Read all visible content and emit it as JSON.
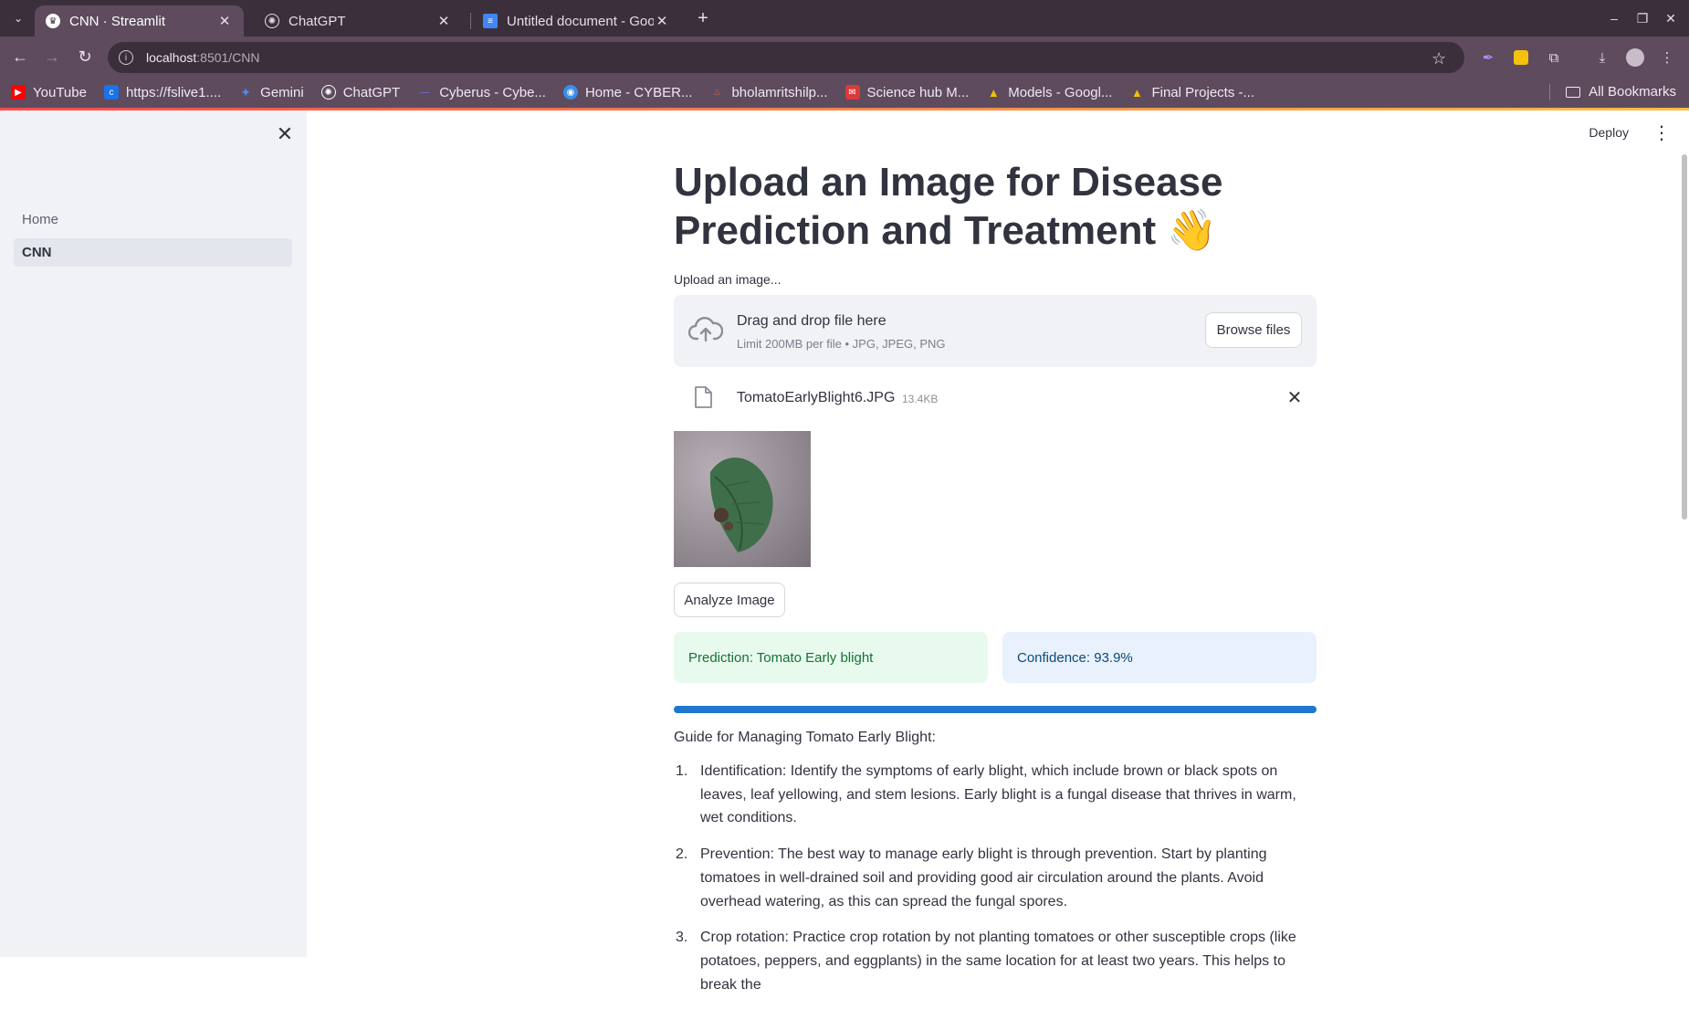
{
  "browser": {
    "tabs": [
      {
        "title": "CNN · Streamlit",
        "active": true
      },
      {
        "title": "ChatGPT",
        "active": false
      },
      {
        "title": "Untitled document - Goo",
        "active": false
      }
    ],
    "url": {
      "host": "localhost",
      "rest": ":8501/CNN"
    },
    "bookmarks": [
      {
        "label": "YouTube",
        "icon": "youtube-icon",
        "color": "#ff0000"
      },
      {
        "label": "https://fslive1....",
        "icon": "site-icon",
        "color": "#1a73e8"
      },
      {
        "label": "Gemini",
        "icon": "gemini-icon",
        "color": "#4a8af4"
      },
      {
        "label": "ChatGPT",
        "icon": "chatgpt-icon",
        "color": "#ffffff"
      },
      {
        "label": "Cyberus - Cybe...",
        "icon": "cyberus-icon",
        "color": "#6f7cff"
      },
      {
        "label": "Home - CYBER...",
        "icon": "cyber-icon",
        "color": "#3a8ee6"
      },
      {
        "label": "bholamritshilp...",
        "icon": "bholamritshilp-icon",
        "color": "#e8703a"
      },
      {
        "label": "Science hub M...",
        "icon": "sciencehub-icon",
        "color": "#d93b3b"
      },
      {
        "label": "Models - Googl...",
        "icon": "drive-icon",
        "color": "#fbbc04"
      },
      {
        "label": "Final Projects -...",
        "icon": "drive-icon",
        "color": "#fbbc04"
      }
    ],
    "all_bookmarks": "All Bookmarks"
  },
  "sidebar": {
    "items": [
      {
        "label": "Home",
        "active": false
      },
      {
        "label": "CNN",
        "active": true
      }
    ]
  },
  "header": {
    "deploy": "Deploy"
  },
  "main": {
    "title": "Upload an Image for Disease Prediction and Treatment 👋",
    "uploader": {
      "label": "Upload an image...",
      "drop_title": "Drag and drop file here",
      "drop_sub": "Limit 200MB per file • JPG, JPEG, PNG",
      "browse": "Browse files"
    },
    "file": {
      "name": "TomatoEarlyBlight6.JPG",
      "size": "13.4KB"
    },
    "analyze": "Analyze Image",
    "prediction": "Prediction: Tomato Early blight",
    "confidence": "Confidence: 93.9%",
    "progress": 1.0,
    "guide_title": "Guide for Managing Tomato Early Blight:",
    "guide": [
      {
        "num": "1.",
        "text": "Identification: Identify the symptoms of early blight, which include brown or black spots on leaves, leaf yellowing, and stem lesions. Early blight is a fungal disease that thrives in warm, wet conditions."
      },
      {
        "num": "2.",
        "text": "Prevention: The best way to manage early blight is through prevention. Start by planting tomatoes in well-drained soil and providing good air circulation around the plants. Avoid overhead watering, as this can spread the fungal spores."
      },
      {
        "num": "3.",
        "text": "Crop rotation: Practice crop rotation by not planting tomatoes or other susceptible crops (like potatoes, peppers, and eggplants) in the same location for at least two years. This helps to break the"
      }
    ]
  },
  "colors": {
    "accent_start": "#ff4b4b",
    "accent_end": "#ffbd45",
    "success_text": "#177233",
    "info_text": "#0c4a7a",
    "progress": "#1f77d0"
  }
}
